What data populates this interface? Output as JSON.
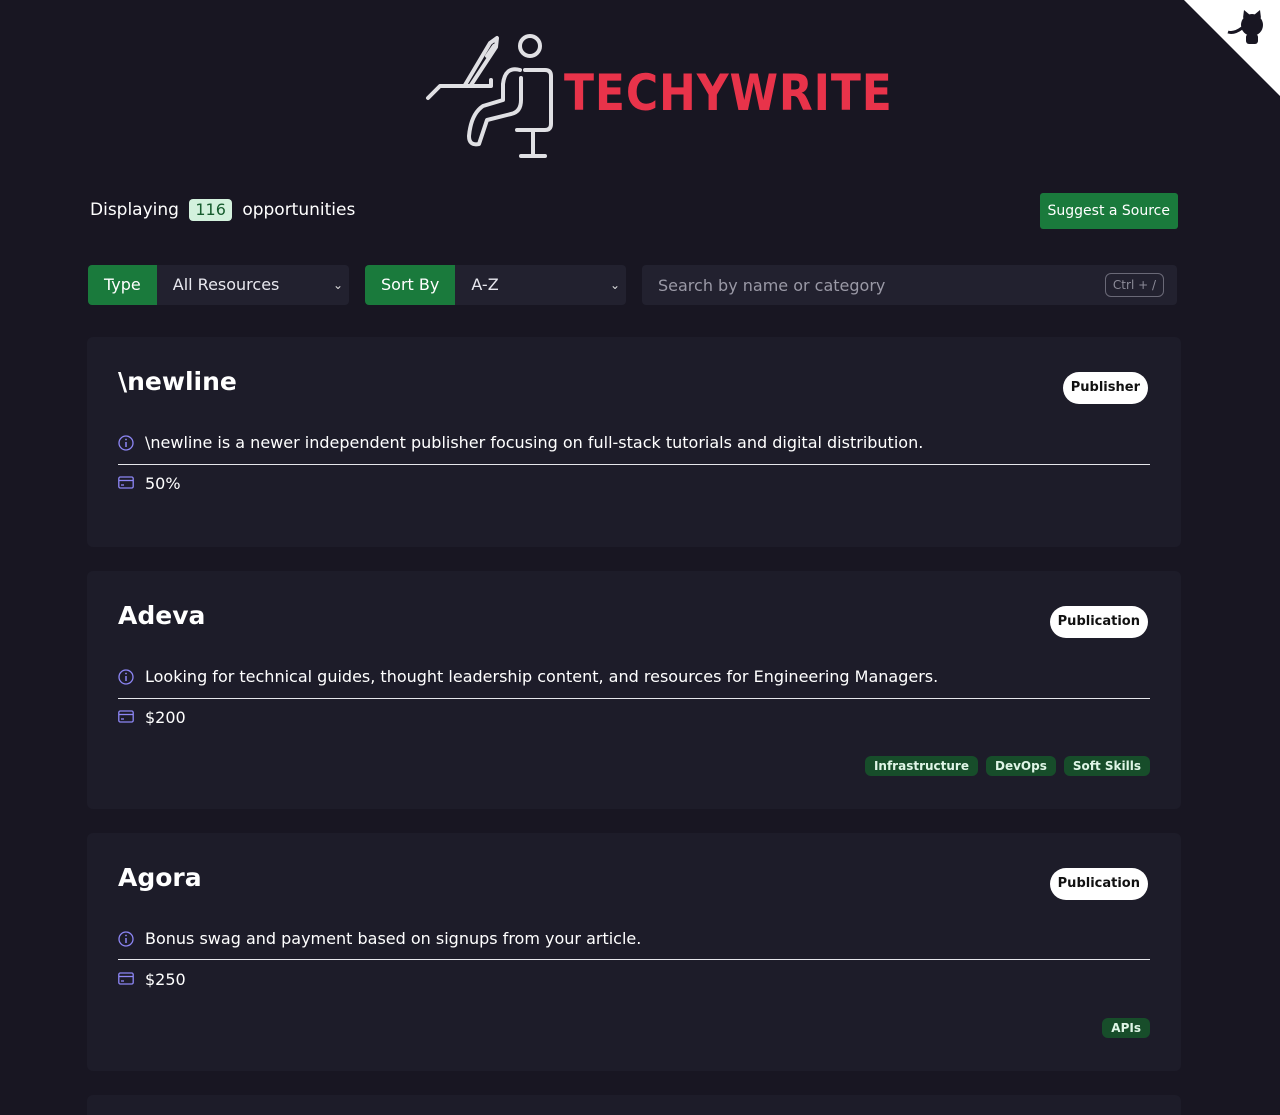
{
  "brand": {
    "name": "TECHYWRITE",
    "logo_icon": "writer-at-desk-icon",
    "logo_color": "#e8334a"
  },
  "corner": {
    "icon": "github-octocat-icon"
  },
  "summary": {
    "prefix": "Displaying",
    "count": "116",
    "suffix": "opportunities"
  },
  "suggest_button": {
    "label": "Suggest a Source"
  },
  "filters": {
    "type": {
      "label": "Type",
      "value": "All Resources"
    },
    "sort": {
      "label": "Sort By",
      "value": "A-Z"
    },
    "search": {
      "placeholder": "Search by name or category",
      "shortcut": "Ctrl + /"
    }
  },
  "colors": {
    "accent": "#1a7a3c",
    "background": "#181622",
    "card": "#1d1c29",
    "tag": "#174d2a"
  },
  "cards": [
    {
      "title": "\\newline",
      "badge": "Publisher",
      "description": "\\newline is a newer independent publisher focusing on full-stack tutorials and digital distribution.",
      "payment": "50%",
      "tags": []
    },
    {
      "title": "Adeva",
      "badge": "Publication",
      "description": "Looking for technical guides, thought leadership content, and resources for Engineering Managers.",
      "payment": "$200",
      "tags": [
        "Infrastructure",
        "DevOps",
        "Soft Skills"
      ]
    },
    {
      "title": "Agora",
      "badge": "Publication",
      "description": "Bonus swag and payment based on signups from your article.",
      "payment": "$250",
      "tags": [
        "APIs"
      ]
    }
  ]
}
